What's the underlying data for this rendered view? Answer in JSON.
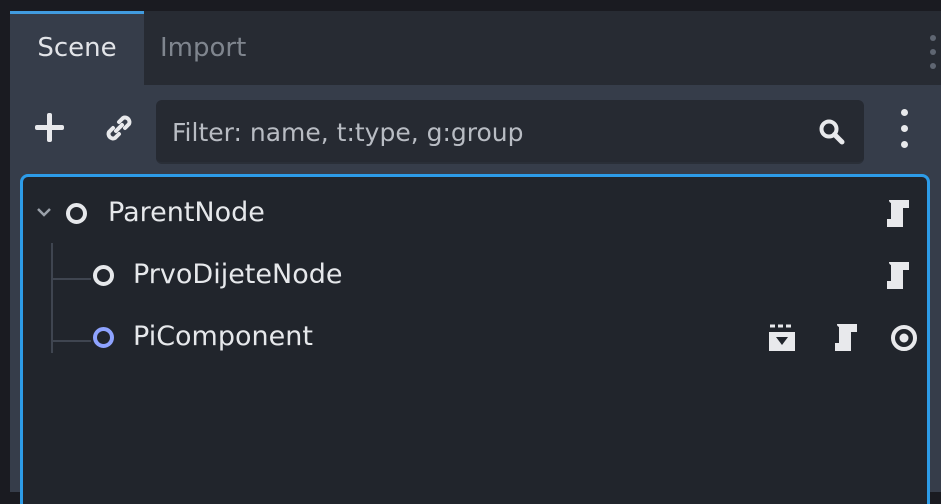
{
  "tabs": [
    {
      "label": "Scene",
      "active": true
    },
    {
      "label": "Import",
      "active": false
    }
  ],
  "toolbar": {
    "add_icon": "plus-icon",
    "link_icon": "link-icon",
    "filter_placeholder": "Filter: name, t:type, g:group",
    "filter_value": "",
    "search_icon": "search-icon",
    "menu_icon": "kebab-menu-icon"
  },
  "tree": {
    "nodes": [
      {
        "name": "ParentNode",
        "depth": 0,
        "expanded": true,
        "icon_color": "#e6e8eb",
        "icons": [
          "script-icon"
        ]
      },
      {
        "name": "PrvoDijeteNode",
        "depth": 1,
        "icon_color": "#e6e8eb",
        "icons": [
          "script-icon"
        ]
      },
      {
        "name": "PiComponent",
        "depth": 1,
        "icon_color": "#8ea3ff",
        "icons": [
          "instanced-scene-icon",
          "script-icon",
          "visibility-eye-icon"
        ]
      }
    ]
  },
  "colors": {
    "accent": "#419ce0",
    "panel_bg": "#363d4a",
    "tree_bg": "#21252c",
    "tree_border": "#2d9ce8"
  }
}
